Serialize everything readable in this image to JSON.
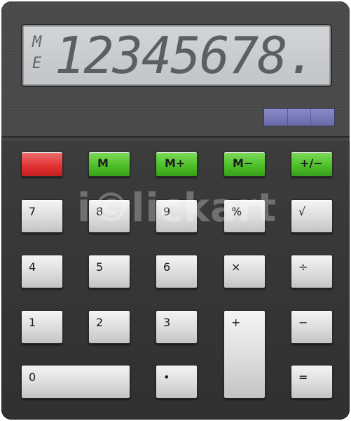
{
  "display": {
    "flags": [
      "M",
      "E"
    ],
    "digits": "12345678."
  },
  "keys": {
    "clear": "",
    "m": "M",
    "m_plus": "M+",
    "m_minus": "M−",
    "plus_minus": "+/−",
    "seven": "7",
    "eight": "8",
    "nine": "9",
    "percent": "%",
    "sqrt": "√",
    "four": "4",
    "five": "5",
    "six": "6",
    "multiply": "×",
    "divide": "÷",
    "one": "1",
    "two": "2",
    "three": "3",
    "plus": "+",
    "minus": "−",
    "zero": "0",
    "decimal": "•",
    "equals": "="
  },
  "watermark": "i©lickart",
  "colors": {
    "body": "#3b3b3b",
    "lcd": "#c8cacc",
    "red_key": "#e03030",
    "green_key": "#4bbd26",
    "solar": "#7a7bbd"
  }
}
